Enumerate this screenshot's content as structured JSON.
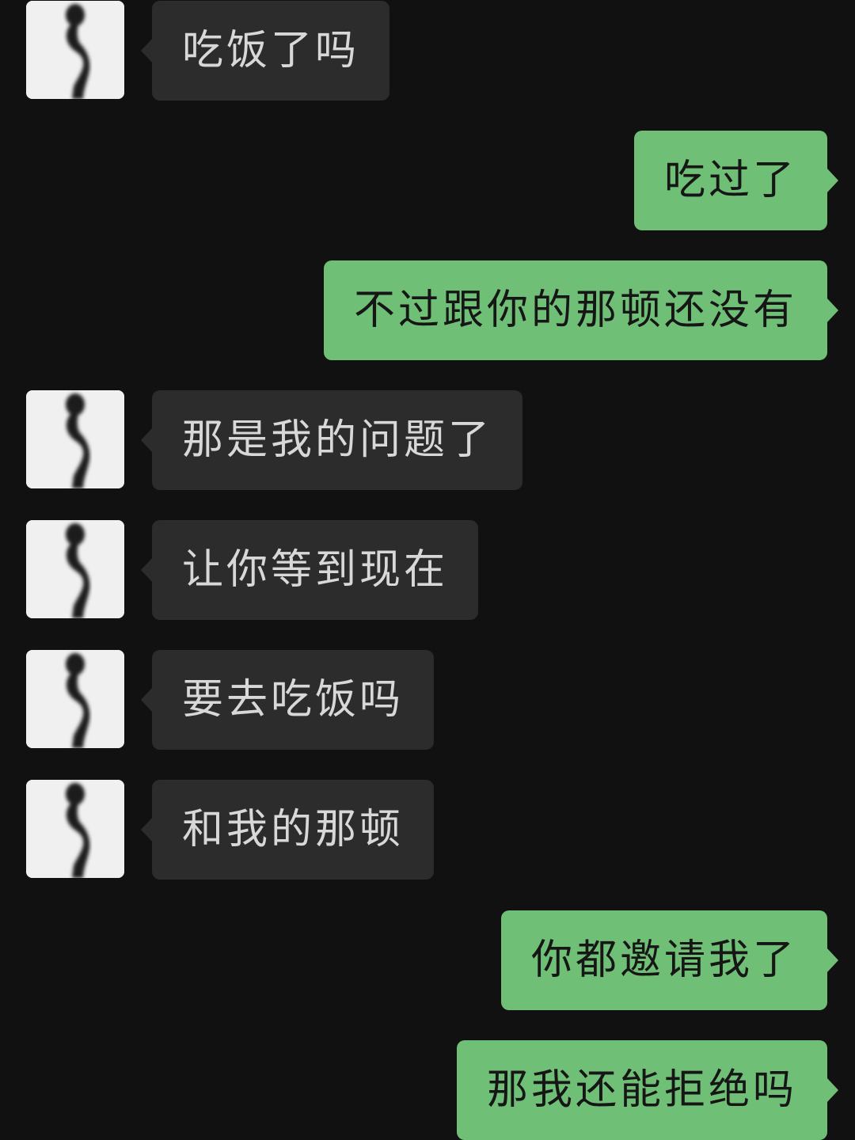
{
  "theme": {
    "background": "#111111",
    "incoming_bubble": "#2c2c2c",
    "incoming_text": "#d8d8d8",
    "outgoing_bubble": "#6fbf76",
    "outgoing_text": "#161616"
  },
  "contact": {
    "avatar_icon": "silhouette-portrait-icon"
  },
  "messages": [
    {
      "side": "in",
      "text": "吃饭了吗"
    },
    {
      "side": "out",
      "text": "吃过了"
    },
    {
      "side": "out",
      "text": "不过跟你的那顿还没有"
    },
    {
      "side": "in",
      "text": "那是我的问题了"
    },
    {
      "side": "in",
      "text": "让你等到现在"
    },
    {
      "side": "in",
      "text": "要去吃饭吗"
    },
    {
      "side": "in",
      "text": "和我的那顿"
    },
    {
      "side": "out",
      "text": "你都邀请我了"
    },
    {
      "side": "out",
      "text": "那我还能拒绝吗"
    }
  ]
}
